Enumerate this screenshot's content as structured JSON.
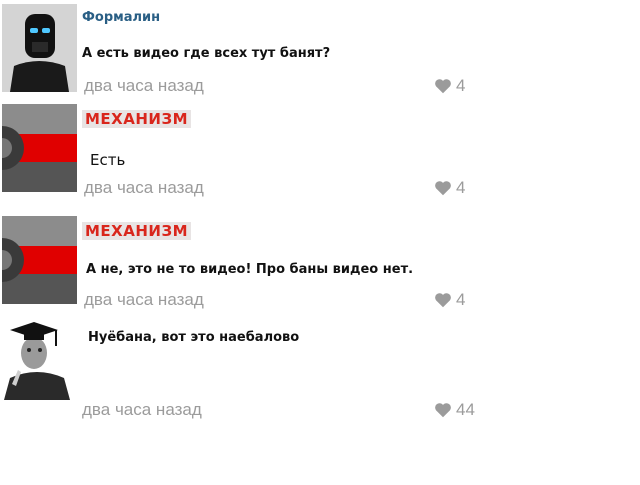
{
  "comments": [
    {
      "author": "Формалин",
      "text": "А есть видео где всех тут банят?",
      "time": "два часа назад",
      "likes": "4"
    },
    {
      "author": "МЕХАНИЗМ",
      "text": "Есть",
      "time": "два часа назад",
      "likes": "4"
    },
    {
      "author": "МЕХАНИЗМ",
      "text": "А не, это не то видео! Про баны видео нет.",
      "time": "два часа назад",
      "likes": "4"
    },
    {
      "author": "",
      "text": "Нуёбана, вот это наебалово",
      "time": "два часа назад",
      "likes": "44"
    }
  ],
  "colors": {
    "author_plain": "#2a5f85",
    "author_boxed": "#d9261c",
    "meta_gray": "#9b9b9b"
  }
}
